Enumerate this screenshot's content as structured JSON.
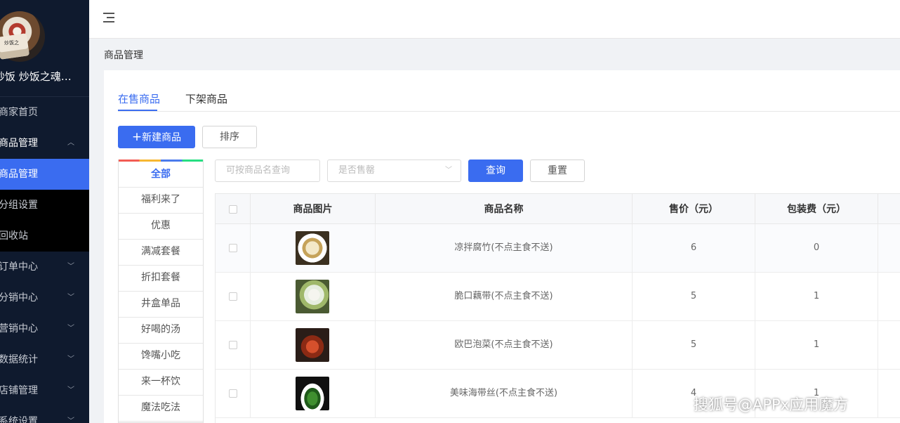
{
  "sidebar": {
    "shop_name": "炒饭 炒饭之魂…",
    "avatar_text": "炒饭之魂",
    "menu": [
      {
        "label": "商家首页",
        "chevron": ""
      },
      {
        "label": "商品管理",
        "chevron": "︿"
      },
      {
        "label": "商品管理",
        "chevron": ""
      },
      {
        "label": "分组设置",
        "chevron": ""
      },
      {
        "label": "回收站",
        "chevron": ""
      },
      {
        "label": "订单中心",
        "chevron": "﹀"
      },
      {
        "label": "分销中心",
        "chevron": "﹀"
      },
      {
        "label": "营销中心",
        "chevron": "﹀"
      },
      {
        "label": "数据统计",
        "chevron": "﹀"
      },
      {
        "label": "店铺管理",
        "chevron": "﹀"
      },
      {
        "label": "系统设置",
        "chevron": "﹀"
      }
    ]
  },
  "breadcrumb": "商品管理",
  "tabs": [
    "在售商品",
    "下架商品"
  ],
  "toolbar": {
    "new_label": "新建商品",
    "new_icon": "+",
    "sort_label": "排序"
  },
  "categories": [
    "全部",
    "福利来了",
    "优惠",
    "满减套餐",
    "折扣套餐",
    "井盒单品",
    "好喝的汤",
    "馋嘴小吃",
    "来一杯饮",
    "魔法吃法"
  ],
  "filters": {
    "name_placeholder": "可按商品名查询",
    "sold_out_placeholder": "是否售罄",
    "query_label": "查询",
    "reset_label": "重置"
  },
  "table": {
    "headers": [
      "商品图片",
      "商品名称",
      "售价（元）",
      "包装费（元）"
    ],
    "rows": [
      {
        "name": "凉拌腐竹(不点主食不送)",
        "price": "6",
        "packing": "0"
      },
      {
        "name": "脆口藕带(不点主食不送)",
        "price": "5",
        "packing": "1"
      },
      {
        "name": "欧巴泡菜(不点主食不送)",
        "price": "5",
        "packing": "1"
      },
      {
        "name": "美味海带丝(不点主食不送)",
        "price": "4",
        "packing": "1"
      }
    ]
  },
  "watermark": "搜狐号@APPx应用魔方",
  "colors": {
    "sidebar_bg": "#0f1a2e",
    "accent": "#3a6cf0"
  }
}
